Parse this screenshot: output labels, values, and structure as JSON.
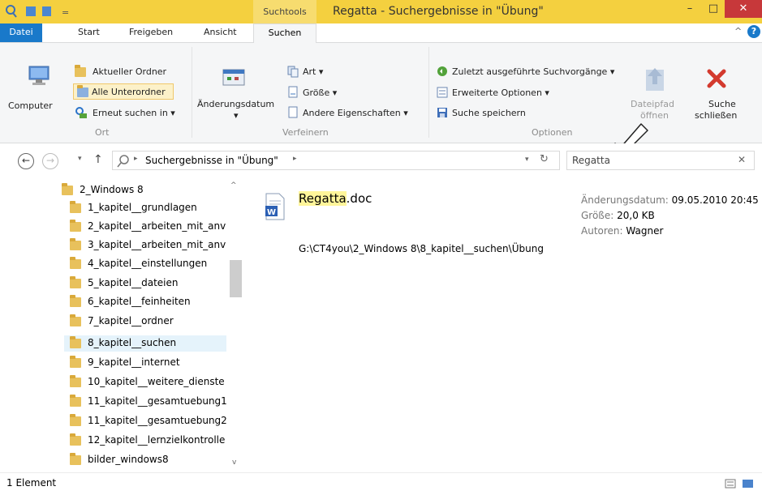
{
  "window": {
    "title": "Regatta - Suchergebnisse in \"Übung\"",
    "context_tab": "Suchtools",
    "controls": {
      "minimize": "–",
      "maximize": "□",
      "close": "✕"
    }
  },
  "ribbon_tabs": [
    "Datei",
    "Start",
    "Freigeben",
    "Ansicht",
    "Suchen"
  ],
  "ribbon": {
    "ort": {
      "computer": "Computer",
      "aktueller_ordner": "Aktueller Ordner",
      "alle_unterordner": "Alle Unterordner",
      "erneut_suchen": "Erneut suchen in ▾",
      "group": "Ort"
    },
    "verfeinern": {
      "aenderungsdatum": "Änderungsdatum",
      "art": "Art ▾",
      "groesse": "Größe ▾",
      "andere": "Andere Eigenschaften ▾",
      "group": "Verfeinern"
    },
    "optionen": {
      "zuletzt": "Zuletzt ausgeführte Suchvorgänge ▾",
      "erweiterte": "Erweiterte Optionen ▾",
      "speichern": "Suche speichern",
      "dateipfad1": "Dateipfad",
      "dateipfad2": "öffnen",
      "suche1": "Suche",
      "suche2": "schließen",
      "group": "Optionen"
    }
  },
  "address": {
    "path": "Suchergebnisse in \"Übung\"",
    "search_value": "Regatta"
  },
  "nav": {
    "root": "2_Windows 8",
    "items": [
      "1_kapitel__grundlagen",
      "2_kapitel__arbeiten_mit_anv",
      "3_kapitel__arbeiten_mit_anv",
      "4_kapitel__einstellungen",
      "5_kapitel__dateien",
      "6_kapitel__feinheiten",
      "7_kapitel__ordner",
      "8_kapitel__suchen",
      "9_kapitel__internet",
      "10_kapitel__weitere_dienste",
      "11_kapitel__gesamtuebung1",
      "11_kapitel__gesamtuebung2",
      "12_kapitel__lernzielkontrolle",
      "bilder_windows8"
    ]
  },
  "result": {
    "name_highlight": "Regatta",
    "name_rest": ".doc",
    "path": "G:\\CT4you\\2_Windows 8\\8_kapitel__suchen\\Übung",
    "date_label": "Änderungsdatum:",
    "date_value": "09.05.2010 20:45",
    "size_label": "Größe:",
    "size_value": "20,0 KB",
    "author_label": "Autoren:",
    "author_value": "Wagner"
  },
  "status": {
    "count": "1 Element"
  }
}
